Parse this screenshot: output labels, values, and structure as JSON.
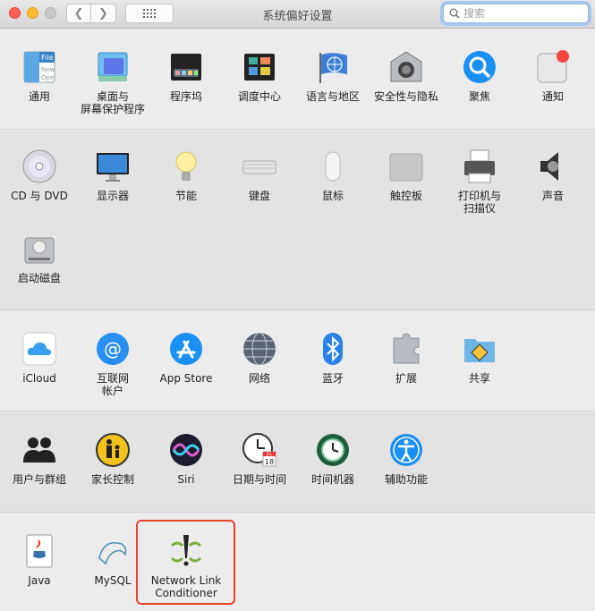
{
  "window": {
    "title": "系统偏好设置"
  },
  "search": {
    "placeholder": "搜索"
  },
  "sections": [
    {
      "items": [
        {
          "label": "通用",
          "icon": "general-icon"
        },
        {
          "label": "桌面与",
          "label2": "屏幕保护程序",
          "icon": "desktop-screensaver-icon"
        },
        {
          "label": "程序坞",
          "icon": "dock-icon"
        },
        {
          "label": "调度中心",
          "icon": "mission-control-icon"
        },
        {
          "label": "语言与地区",
          "icon": "language-region-icon"
        },
        {
          "label": "安全性与隐私",
          "icon": "security-privacy-icon"
        },
        {
          "label": "聚焦",
          "icon": "spotlight-icon"
        },
        {
          "label": "通知",
          "icon": "notifications-icon"
        }
      ]
    },
    {
      "items": [
        {
          "label": "CD 与 DVD",
          "icon": "cd-dvd-icon"
        },
        {
          "label": "显示器",
          "icon": "displays-icon"
        },
        {
          "label": "节能",
          "icon": "energy-saver-icon"
        },
        {
          "label": "键盘",
          "icon": "keyboard-icon"
        },
        {
          "label": "鼠标",
          "icon": "mouse-icon"
        },
        {
          "label": "触控板",
          "icon": "trackpad-icon"
        },
        {
          "label": "打印机与",
          "label2": "扫描仪",
          "icon": "printer-scanner-icon"
        },
        {
          "label": "声音",
          "icon": "sound-icon"
        },
        {
          "label": "启动磁盘",
          "icon": "startup-disk-icon"
        }
      ]
    },
    {
      "items": [
        {
          "label": "iCloud",
          "icon": "icloud-icon"
        },
        {
          "label": "互联网",
          "label2": "帐户",
          "icon": "internet-accounts-icon"
        },
        {
          "label": "App Store",
          "icon": "app-store-icon"
        },
        {
          "label": "网络",
          "icon": "network-icon"
        },
        {
          "label": "蓝牙",
          "icon": "bluetooth-icon"
        },
        {
          "label": "扩展",
          "icon": "extensions-icon"
        },
        {
          "label": "共享",
          "icon": "sharing-icon"
        }
      ]
    },
    {
      "items": [
        {
          "label": "用户与群组",
          "icon": "users-groups-icon"
        },
        {
          "label": "家长控制",
          "icon": "parental-controls-icon"
        },
        {
          "label": "Siri",
          "icon": "siri-icon"
        },
        {
          "label": "日期与时间",
          "icon": "date-time-icon"
        },
        {
          "label": "时间机器",
          "icon": "time-machine-icon"
        },
        {
          "label": "辅助功能",
          "icon": "accessibility-icon"
        }
      ]
    },
    {
      "items": [
        {
          "label": "Java",
          "icon": "java-icon"
        },
        {
          "label": "MySQL",
          "icon": "mysql-icon"
        },
        {
          "label": "Network Link",
          "label2": "Conditioner",
          "icon": "network-link-conditioner-icon"
        }
      ]
    }
  ],
  "icon_texts": {
    "general_file": "File",
    "general_new": "New",
    "general_open": "Ope",
    "calendar_month": "JUL",
    "calendar_day": "18"
  },
  "colors": {
    "accent_blue": "#1a8ff5",
    "highlight_red": "#e8422c",
    "notification_red": "#f3473c"
  }
}
